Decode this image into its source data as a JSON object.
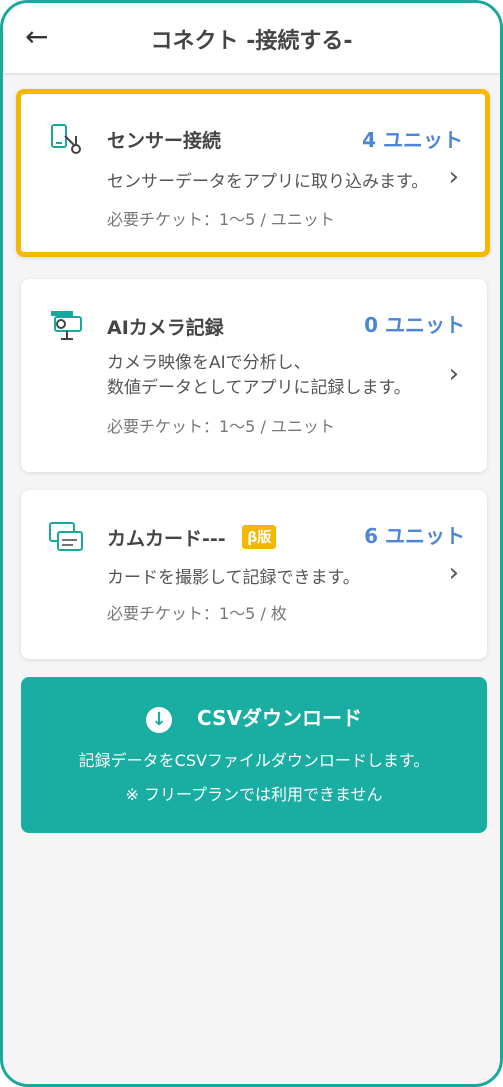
{
  "header": {
    "back_icon": "←",
    "title": "コネクト -接続する-"
  },
  "cards": [
    {
      "icon": "sensor-icon",
      "title": "センサー接続",
      "units": "4 ユニット",
      "description": "センサーデータをアプリに取り込みます。",
      "ticket": "必要チケット：1～5 / ユニット"
    },
    {
      "icon": "camera-icon",
      "title": "AIカメラ記録",
      "units": "0 ユニット",
      "description": "カメラ映像をAIで分析し、\n数値データとしてアプリに記録します。",
      "ticket": "必要チケット：1～5 / ユニット"
    },
    {
      "icon": "card-icon",
      "title": "カムカード---",
      "badge": "β版",
      "units": "6 ユニット",
      "description": "カードを撮影して記録できます。",
      "ticket": "必要チケット：1～5 / 枚"
    }
  ],
  "chevron": "›",
  "csv": {
    "title": "CSVダウンロード",
    "description": "記録データをCSVファイルダウンロードします。",
    "note": "※ フリープランでは利用できません"
  },
  "colors": {
    "accent": "#1aa79c",
    "highlight": "#f5b800",
    "units": "#4d86d6"
  }
}
